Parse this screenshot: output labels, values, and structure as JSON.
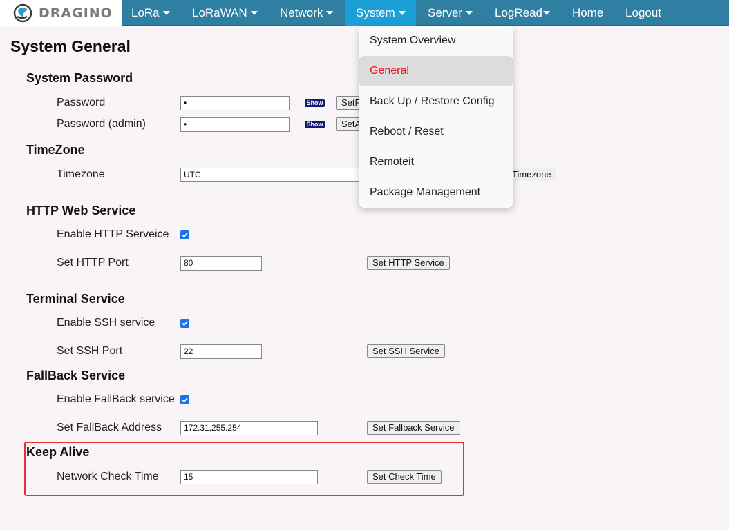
{
  "brand": {
    "logo_text": "DRAGINO"
  },
  "nav": {
    "items": [
      {
        "label": "LoRa",
        "has_caret": true
      },
      {
        "label": "LoRaWAN",
        "has_caret": true
      },
      {
        "label": "Network",
        "has_caret": true
      },
      {
        "label": "System",
        "has_caret": true,
        "active": true
      },
      {
        "label": "Server",
        "has_caret": true
      },
      {
        "label": "LogRead",
        "has_caret": true
      },
      {
        "label": "Home",
        "has_caret": false
      },
      {
        "label": "Logout",
        "has_caret": false
      }
    ]
  },
  "dropdown": {
    "items": [
      {
        "label": "System Overview"
      },
      {
        "label": "General",
        "active": true
      },
      {
        "label": "Back Up / Restore Config"
      },
      {
        "label": "Reboot / Reset"
      },
      {
        "label": "Remoteit"
      },
      {
        "label": "Package Management"
      }
    ]
  },
  "page": {
    "title": "System General"
  },
  "password_section": {
    "heading": "System Password",
    "password_label": "Password",
    "password_value": "•",
    "admin_label": "Password (admin)",
    "admin_value": "•",
    "show_label": "Show",
    "set_password_btn": "SetP",
    "set_admin_btn": "SetA"
  },
  "timezone_section": {
    "heading": "TimeZone",
    "label": "Timezone",
    "value": "UTC",
    "set_btn": "Timezone"
  },
  "http_section": {
    "heading": "HTTP Web Service",
    "enable_label": "Enable HTTP Serveice",
    "enabled": true,
    "port_label": "Set HTTP Port",
    "port_value": "80",
    "set_btn": "Set HTTP Service"
  },
  "terminal_section": {
    "heading": "Terminal Service",
    "enable_label": "Enable SSH service",
    "enabled": true,
    "port_label": "Set SSH Port",
    "port_value": "22",
    "set_btn": "Set SSH Service"
  },
  "fallback_section": {
    "heading": "FallBack Service",
    "enable_label": "Enable FallBack service",
    "enabled": true,
    "address_label": "Set FallBack Address",
    "address_value": "172.31.255.254",
    "set_btn": "Set Fallback Service"
  },
  "keepalive_section": {
    "heading": "Keep Alive",
    "label": "Network Check Time",
    "value": "15",
    "set_btn": "Set Check Time"
  },
  "colors": {
    "nav_bg": "#2e7fa1",
    "nav_active": "#1aa0d6",
    "page_bg": "#f8f4f7",
    "dropdown_active_text": "#e01b24",
    "highlight_border": "#e5302c",
    "checkbox": "#1a73e8"
  }
}
